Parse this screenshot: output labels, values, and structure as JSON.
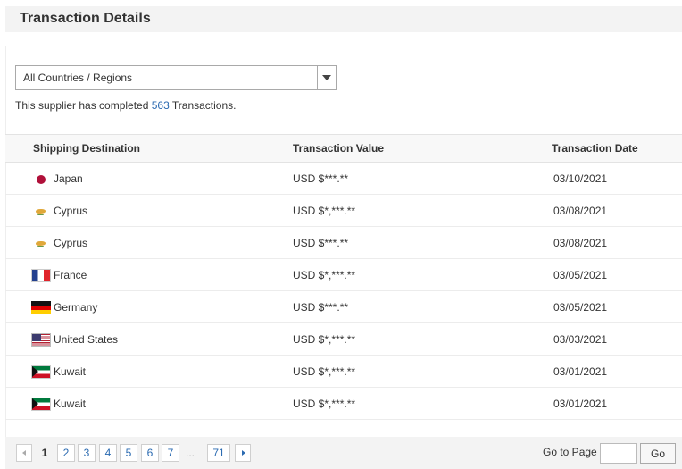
{
  "header": {
    "title": "Transaction Details"
  },
  "filter": {
    "selected": "All Countries / Regions",
    "icon": "chevron-down-icon"
  },
  "summary": {
    "prefix": "This supplier has completed ",
    "count": "563",
    "suffix": " Transactions."
  },
  "table": {
    "columns": [
      "Shipping Destination",
      "Transaction Value",
      "Transaction Date"
    ],
    "rows": [
      {
        "flag": "japan-flag-icon",
        "country": "Japan",
        "value": "USD $***.**",
        "date": "03/10/2021"
      },
      {
        "flag": "cyprus-flag-icon",
        "country": "Cyprus",
        "value": "USD $*,***.**",
        "date": "03/08/2021"
      },
      {
        "flag": "cyprus-flag-icon",
        "country": "Cyprus",
        "value": "USD $***.**",
        "date": "03/08/2021"
      },
      {
        "flag": "france-flag-icon",
        "country": "France",
        "value": "USD $*,***.**",
        "date": "03/05/2021"
      },
      {
        "flag": "germany-flag-icon",
        "country": "Germany",
        "value": "USD $***.**",
        "date": "03/05/2021"
      },
      {
        "flag": "united-states-flag-icon",
        "country": "United States",
        "value": "USD $*,***.**",
        "date": "03/03/2021"
      },
      {
        "flag": "kuwait-flag-icon",
        "country": "Kuwait",
        "value": "USD $*,***.**",
        "date": "03/01/2021"
      },
      {
        "flag": "kuwait-flag-icon",
        "country": "Kuwait",
        "value": "USD $*,***.**",
        "date": "03/01/2021"
      }
    ]
  },
  "pagination": {
    "current": "1",
    "pages": [
      "2",
      "3",
      "4",
      "5",
      "6",
      "7"
    ],
    "ellipsis": "...",
    "last": "71",
    "goto_label": "Go to Page",
    "goto_value": "",
    "go_button": "Go"
  },
  "colors": {
    "link": "#2a6ab1",
    "header_bg": "#f3f3f3"
  }
}
